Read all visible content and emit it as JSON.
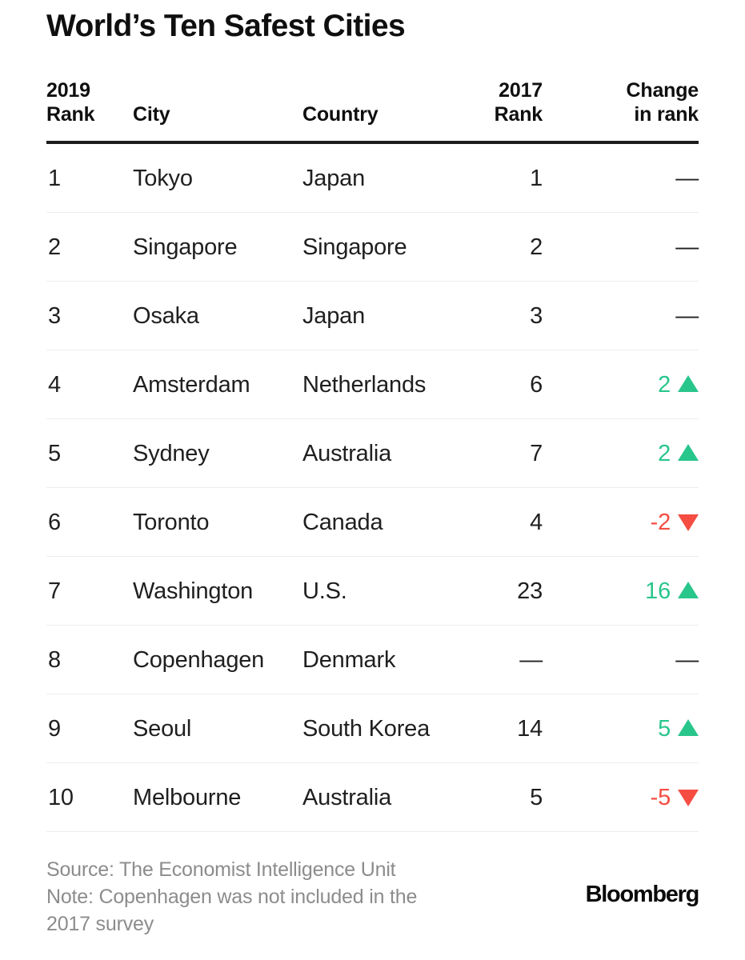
{
  "title": "World’s Ten Safest Cities",
  "colors": {
    "up": "#29c68c",
    "down": "#f54d42",
    "text": "#1f1f1f",
    "muted": "#8c8c8c",
    "rule": "#1c1c1c",
    "separator": "#ececec"
  },
  "table": {
    "headers": {
      "rank_2019": "2019\nRank",
      "city": "City",
      "country": "Country",
      "rank_2017": "2017\nRank",
      "change": "Change\nin rank"
    },
    "rows": [
      {
        "rank_2019": "1",
        "city": "Tokyo",
        "country": "Japan",
        "rank_2017": "1",
        "change": "—",
        "direction": "flat"
      },
      {
        "rank_2019": "2",
        "city": "Singapore",
        "country": "Singapore",
        "rank_2017": "2",
        "change": "—",
        "direction": "flat"
      },
      {
        "rank_2019": "3",
        "city": "Osaka",
        "country": "Japan",
        "rank_2017": "3",
        "change": "—",
        "direction": "flat"
      },
      {
        "rank_2019": "4",
        "city": "Amsterdam",
        "country": "Netherlands",
        "rank_2017": "6",
        "change": "2",
        "direction": "up"
      },
      {
        "rank_2019": "5",
        "city": "Sydney",
        "country": "Australia",
        "rank_2017": "7",
        "change": "2",
        "direction": "up"
      },
      {
        "rank_2019": "6",
        "city": "Toronto",
        "country": "Canada",
        "rank_2017": "4",
        "change": "-2",
        "direction": "down"
      },
      {
        "rank_2019": "7",
        "city": "Washington",
        "country": "U.S.",
        "rank_2017": "23",
        "change": "16",
        "direction": "up"
      },
      {
        "rank_2019": "8",
        "city": "Copenhagen",
        "country": "Denmark",
        "rank_2017": "—",
        "change": "—",
        "direction": "flat"
      },
      {
        "rank_2019": "9",
        "city": "Seoul",
        "country": "South Korea",
        "rank_2017": "14",
        "change": "5",
        "direction": "up"
      },
      {
        "rank_2019": "10",
        "city": "Melbourne",
        "country": "Australia",
        "rank_2017": "5",
        "change": "-5",
        "direction": "down"
      }
    ]
  },
  "footer": {
    "source_line1": "Source: The Economist Intelligence Unit",
    "source_line2": "Note: Copenhagen was not included in the",
    "source_line3": "2017 survey",
    "brand": "Bloomberg"
  }
}
